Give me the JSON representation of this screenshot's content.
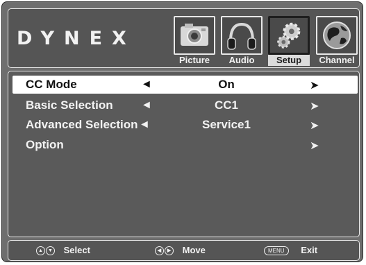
{
  "brand": {
    "logo": "DYNEX"
  },
  "tabs": [
    {
      "label": "Picture",
      "icon": "camera-icon",
      "active": false
    },
    {
      "label": "Audio",
      "icon": "headphones-icon",
      "active": false
    },
    {
      "label": "Setup",
      "icon": "gears-icon",
      "active": true
    },
    {
      "label": "Channel",
      "icon": "globe-icon",
      "active": false
    }
  ],
  "menu": {
    "rows": [
      {
        "label": "CC Mode",
        "value": "On",
        "selected": true
      },
      {
        "label": "Basic Selection",
        "value": "CC1",
        "selected": false
      },
      {
        "label": "Advanced Selection",
        "value": "Service1",
        "selected": false
      },
      {
        "label": "Option",
        "value": "",
        "selected": false
      }
    ],
    "left_arrow": "◄",
    "right_arrow": "➤"
  },
  "footer": {
    "select_label": "Select",
    "move_label": "Move",
    "menu_key": "MENU",
    "exit_label": "Exit"
  }
}
